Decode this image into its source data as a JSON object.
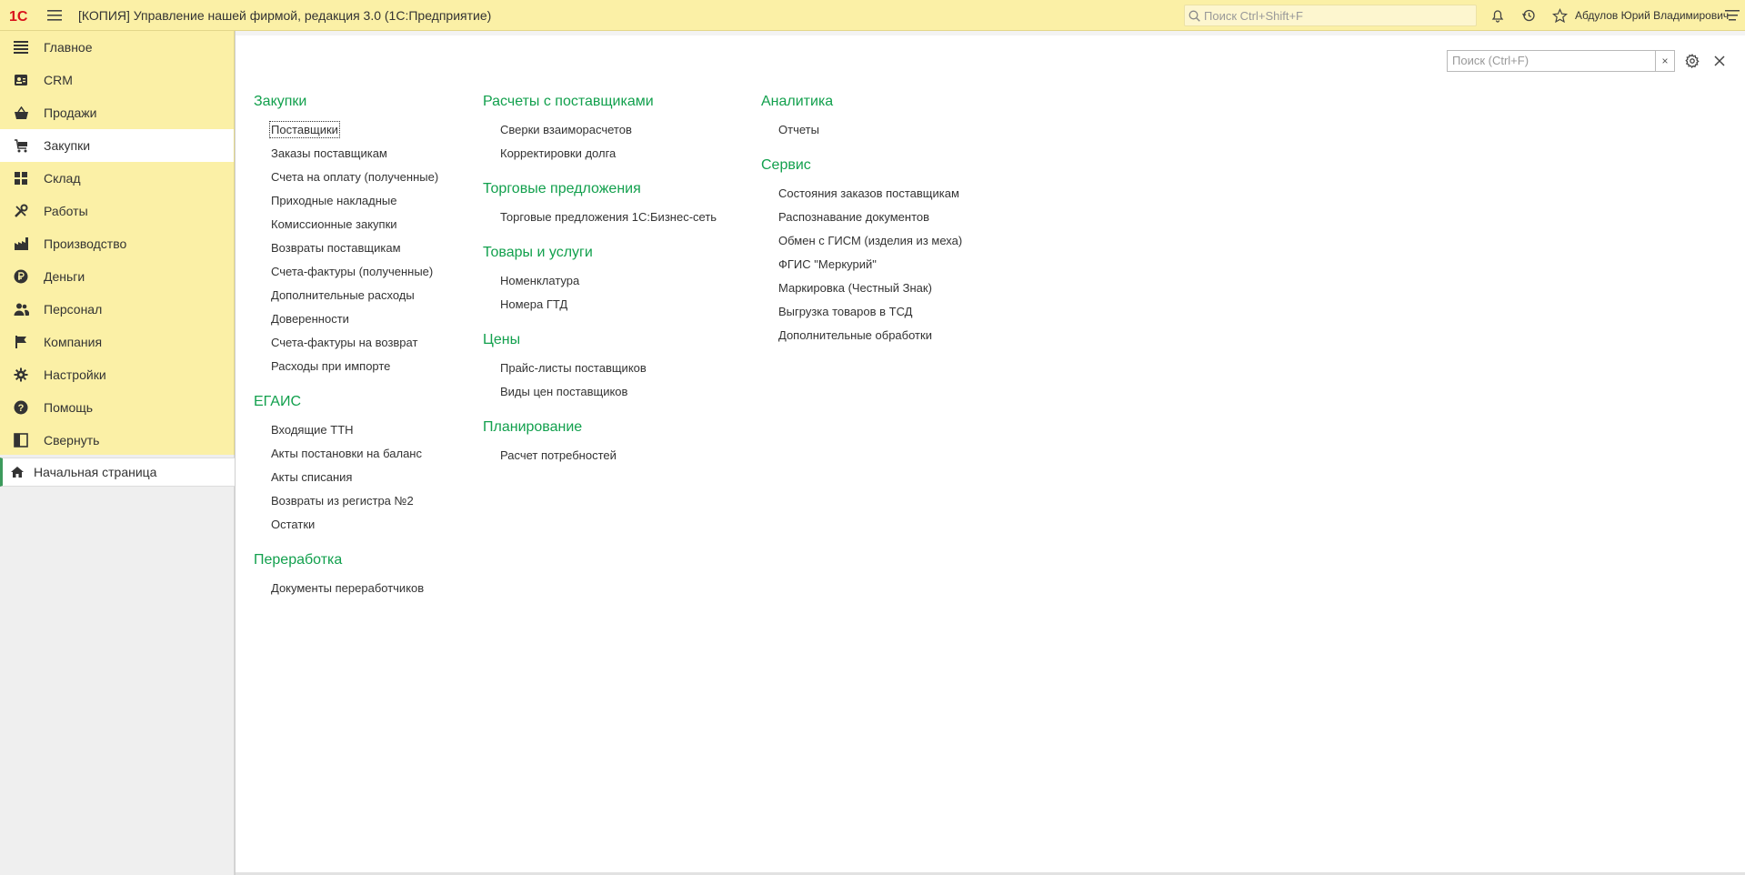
{
  "app": {
    "title": "[КОПИЯ] Управление нашей фирмой, редакция 3.0  (1С:Предприятие)",
    "global_search_placeholder": "Поиск Ctrl+Shift+F",
    "user_name": "Абдулов Юрий Владимирович",
    "logo_text": "1С",
    "accent_color": "#12a04d",
    "panel_color": "#fbf0a6",
    "logo_color": "#d9141b"
  },
  "sidebar": {
    "items": [
      {
        "label": "Главное",
        "icon": "list-icon"
      },
      {
        "label": "CRM",
        "icon": "contacts-icon"
      },
      {
        "label": "Продажи",
        "icon": "basket-icon"
      },
      {
        "label": "Закупки",
        "icon": "cart-icon",
        "active": true
      },
      {
        "label": "Склад",
        "icon": "grid-icon"
      },
      {
        "label": "Работы",
        "icon": "tools-icon"
      },
      {
        "label": "Производство",
        "icon": "factory-icon"
      },
      {
        "label": "Деньги",
        "icon": "ruble-icon"
      },
      {
        "label": "Персонал",
        "icon": "people-icon"
      },
      {
        "label": "Компания",
        "icon": "flag-icon"
      },
      {
        "label": "Настройки",
        "icon": "gear-icon"
      },
      {
        "label": "Помощь",
        "icon": "help-icon"
      },
      {
        "label": "Свернуть",
        "icon": "collapse-icon"
      }
    ],
    "home_tab": "Начальная страница"
  },
  "main": {
    "search_placeholder": "Поиск (Ctrl+F)",
    "clear_label": "×",
    "columns": [
      [
        {
          "title": "Закупки",
          "items": [
            "Поставщики",
            "Заказы поставщикам",
            "Счета на оплату (полученные)",
            "Приходные накладные",
            "Комиссионные закупки",
            "Возвраты поставщикам",
            "Счета-фактуры (полученные)",
            "Дополнительные расходы",
            "Доверенности",
            "Счета-фактуры на возврат",
            "Расходы при импорте"
          ]
        },
        {
          "title": "ЕГАИС",
          "items": [
            "Входящие ТТН",
            "Акты постановки на баланс",
            "Акты списания",
            "Возвраты из регистра №2",
            "Остатки"
          ]
        },
        {
          "title": "Переработка",
          "items": [
            "Документы переработчиков"
          ]
        }
      ],
      [
        {
          "title": "Расчеты с поставщиками",
          "items": [
            "Сверки взаиморасчетов",
            "Корректировки долга"
          ]
        },
        {
          "title": "Торговые предложения",
          "items": [
            "Торговые предложения 1С:Бизнес-сеть"
          ]
        },
        {
          "title": "Товары и услуги",
          "items": [
            "Номенклатура",
            "Номера ГТД"
          ]
        },
        {
          "title": "Цены",
          "items": [
            "Прайс-листы поставщиков",
            "Виды цен поставщиков"
          ]
        },
        {
          "title": "Планирование",
          "items": [
            "Расчет потребностей"
          ]
        }
      ],
      [
        {
          "title": "Аналитика",
          "items": [
            "Отчеты"
          ]
        },
        {
          "title": "Сервис",
          "items": [
            "Состояния заказов поставщикам",
            "Распознавание документов",
            "Обмен с ГИСМ (изделия из меха)",
            "ФГИС \"Меркурий\"",
            "Маркировка (Честный Знак)",
            "Выгрузка товаров в ТСД",
            "Дополнительные обработки"
          ]
        }
      ]
    ]
  }
}
